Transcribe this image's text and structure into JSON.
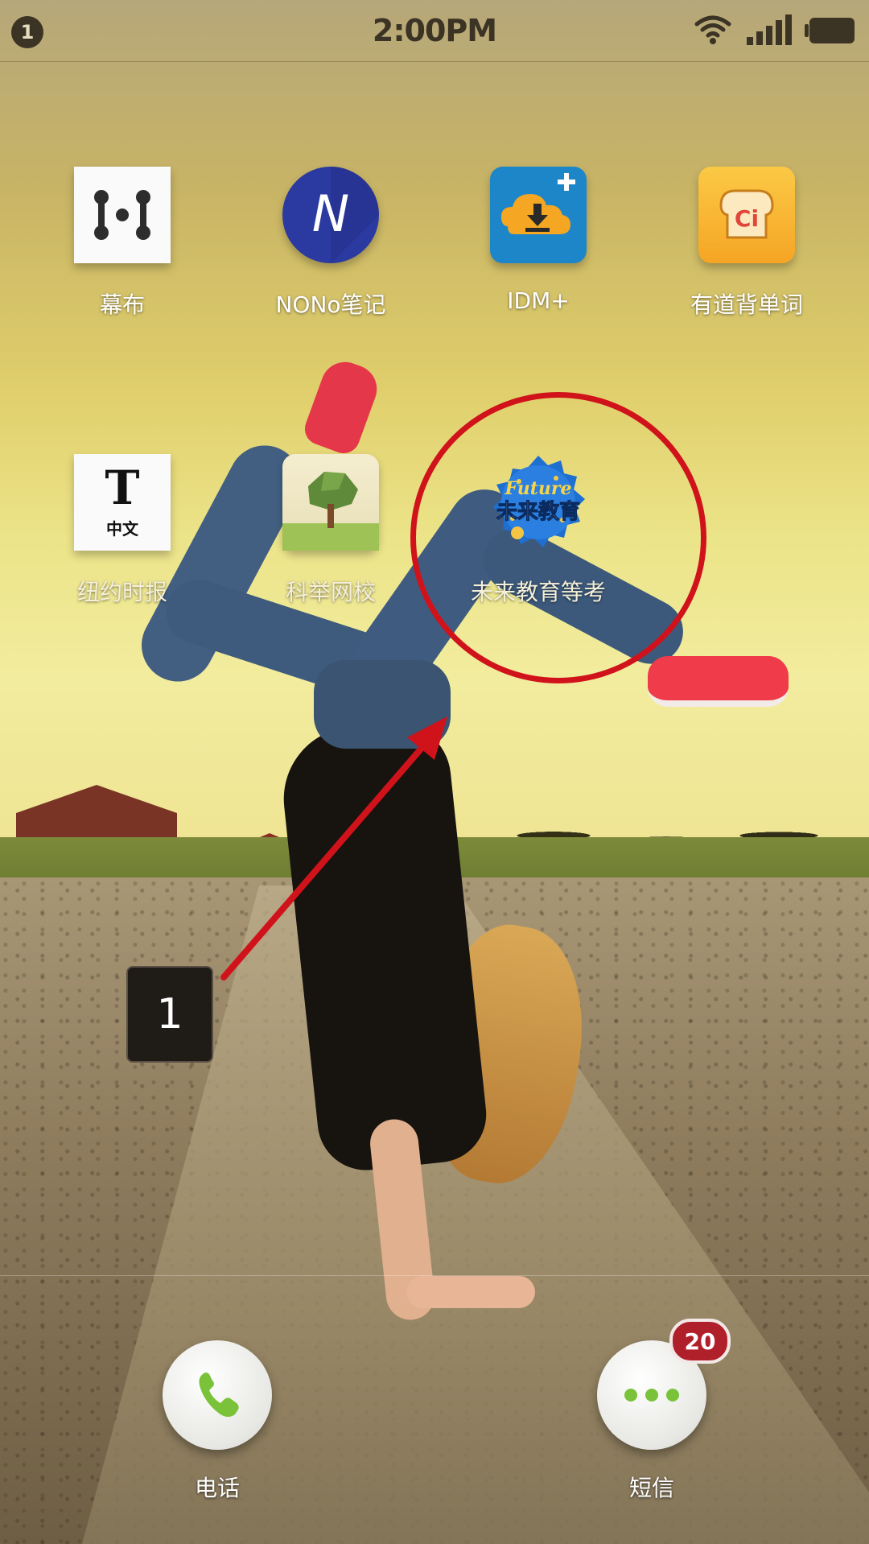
{
  "status_bar": {
    "notification_count": "1",
    "time": "2:00PM",
    "icons": [
      "wifi-icon",
      "signal-icon",
      "battery-icon"
    ]
  },
  "apps": [
    {
      "label": "幕布",
      "icon": "mubu-icon",
      "tile_text": ""
    },
    {
      "label": "NONo笔记",
      "icon": "nono-notes-icon",
      "tile_text": "N"
    },
    {
      "label": "IDM+",
      "icon": "idm-plus-icon",
      "tile_text": ""
    },
    {
      "label": "有道背单词",
      "icon": "youdao-words-icon",
      "tile_text": "Ci"
    },
    {
      "label": "纽约时报",
      "icon": "nytimes-icon",
      "tile_text": "中文"
    },
    {
      "label": "科举网校",
      "icon": "keju-school-icon",
      "tile_text": ""
    },
    {
      "label": "未来教育等考",
      "icon": "future-education-icon",
      "tile_text_top": "Future",
      "tile_text": "未来教育"
    }
  ],
  "annotation": {
    "step": "1",
    "color": "#d0121b"
  },
  "dock": {
    "phone_label": "电话",
    "sms_label": "短信",
    "sms_badge": "20"
  }
}
